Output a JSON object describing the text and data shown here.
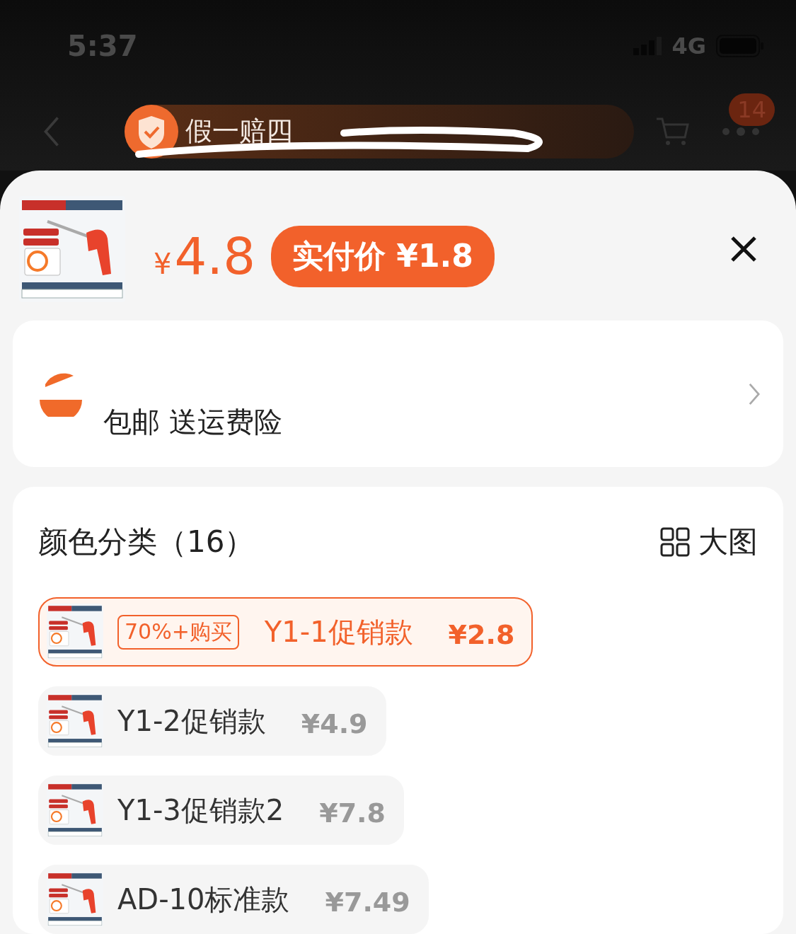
{
  "status_bar": {
    "time": "5:37",
    "network": "4G"
  },
  "nav": {
    "banner": "假一赔四",
    "badge": "14"
  },
  "product": {
    "price_symbol": "¥",
    "price": "4.8",
    "final_price": "实付价 ¥1.8"
  },
  "shop": {
    "shipping": "包邮 送运费险"
  },
  "options": {
    "title": "颜色分类（16）",
    "view_toggle": "大图",
    "items": [
      {
        "name": "Y1-1促销款",
        "price": "¥2.8",
        "tag": "70%+购买",
        "selected": true
      },
      {
        "name": "Y1-2促销款",
        "price": "¥4.9",
        "selected": false
      },
      {
        "name": "Y1-3促销款2",
        "price": "¥7.8",
        "selected": false
      },
      {
        "name": "AD-10标准款",
        "price": "¥7.49",
        "selected": false
      }
    ]
  }
}
